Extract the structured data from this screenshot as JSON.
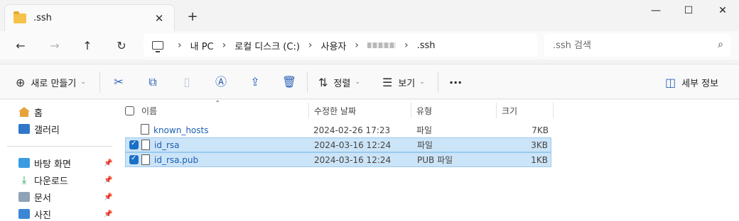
{
  "tab": {
    "title": ".ssh",
    "close_glyph": "✕",
    "new_tab_glyph": "+"
  },
  "window_controls": {
    "minimize": "—",
    "maximize": "☐",
    "close": "✕"
  },
  "nav": {
    "back_icon": "arrow-left",
    "forward_icon": "arrow-right",
    "up_icon": "arrow-up",
    "refresh_icon": "refresh",
    "breadcrumbs": [
      "내 PC",
      "로컬 디스크 (C:)",
      "사용자",
      "",
      ".ssh"
    ]
  },
  "search": {
    "placeholder": ".ssh 검색"
  },
  "commands": {
    "new_label": "새로 만들기",
    "sort_label": "정렬",
    "view_label": "보기",
    "more_label": "···",
    "details_label": "세부 정보"
  },
  "sidebar": {
    "items": [
      {
        "label": "홈",
        "icon": "home-icon",
        "pinned": false
      },
      {
        "label": "갤러리",
        "icon": "gallery-icon",
        "pinned": false
      },
      {
        "label": "바탕 화면",
        "icon": "desktop-icon",
        "pinned": true
      },
      {
        "label": "다운로드",
        "icon": "download-icon",
        "pinned": true
      },
      {
        "label": "문서",
        "icon": "document-icon",
        "pinned": true
      },
      {
        "label": "사진",
        "icon": "picture-icon",
        "pinned": true
      }
    ]
  },
  "columns": {
    "name": "이름",
    "date": "수정한 날짜",
    "type": "유형",
    "size": "크기"
  },
  "files": [
    {
      "name": "known_hosts",
      "date": "2024-02-26 17:23",
      "type": "파일",
      "size": "7KB",
      "selected": false
    },
    {
      "name": "id_rsa",
      "date": "2024-03-16 12:24",
      "type": "파일",
      "size": "3KB",
      "selected": true
    },
    {
      "name": "id_rsa.pub",
      "date": "2024-03-16 12:24",
      "type": "PUB 파일",
      "size": "1KB",
      "selected": true
    }
  ],
  "colors": {
    "accent": "#1a6fc8",
    "selection": "#cce4f7",
    "link_text": "#1a5fb4"
  }
}
